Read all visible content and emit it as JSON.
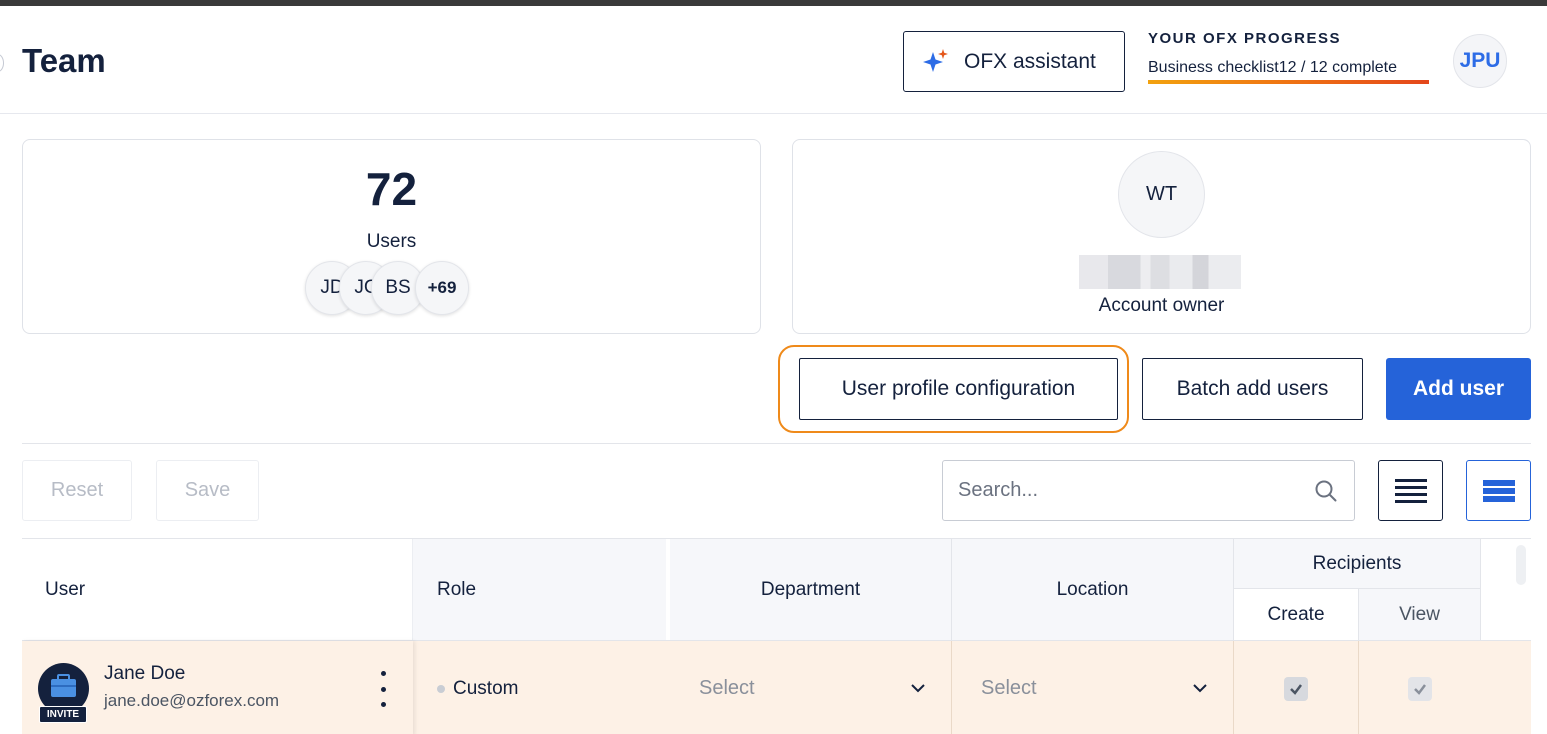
{
  "header": {
    "title": "Team",
    "assistant_label": "OFX assistant",
    "progress_title": "YOUR OFX PROGRESS",
    "progress_text": "Business checklist12 / 12 complete",
    "progress_fraction": 1.0,
    "user_initials": "JPU"
  },
  "summary": {
    "users_count": "72",
    "users_label": "Users",
    "avatars": [
      "JD",
      "JC",
      "BS"
    ],
    "more_count": "+69",
    "owner_initials": "WT",
    "owner_label": "Account owner"
  },
  "actions": {
    "config_label": "User profile configuration",
    "batch_label": "Batch add users",
    "add_label": "Add user"
  },
  "toolbar": {
    "reset_label": "Reset",
    "save_label": "Save",
    "search_placeholder": "Search..."
  },
  "table": {
    "headers": {
      "user": "User",
      "role": "Role",
      "department": "Department",
      "location": "Location",
      "recipients": "Recipients",
      "create": "Create",
      "view": "View"
    },
    "rows": [
      {
        "name": "Jane Doe",
        "email": "jane.doe@ozforex.com",
        "badge": "INVITE",
        "role": "Custom",
        "department": "Select",
        "location": "Select",
        "recipients_create": true,
        "recipients_view": true
      }
    ]
  },
  "colors": {
    "primary": "#2563d9",
    "navy": "#14213d",
    "highlight": "#ef8a1a",
    "row_highlight": "#fdf1e6"
  }
}
